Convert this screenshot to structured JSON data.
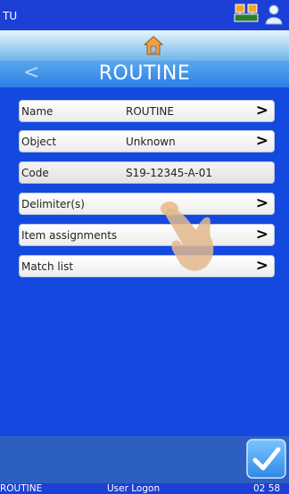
{
  "topbar": {
    "app_name": "TU",
    "icons": [
      "network-icon",
      "user-icon"
    ]
  },
  "nav": {
    "home_icon": "home-icon",
    "back_icon": "chevron-left-icon",
    "title": "ROUTINE"
  },
  "rows": [
    {
      "label": "Name",
      "value": "ROUTINE",
      "chevron": true
    },
    {
      "label": "Object",
      "value": "Unknown",
      "chevron": true
    },
    {
      "label": "Code",
      "value": "S19-12345-A-01",
      "chevron": false
    },
    {
      "label": "Delimiter(s)",
      "value": "",
      "chevron": true
    },
    {
      "label": "Item assignments",
      "value": "",
      "chevron": true
    },
    {
      "label": "Match list",
      "value": "",
      "chevron": true
    }
  ],
  "chevron_glyph": ">",
  "back_glyph": "<",
  "confirm_icon": "checkmark-icon",
  "overlay_icon": "tap-hand-icon",
  "status": {
    "left": "ROUTINE",
    "center": "User Logon",
    "right": "02 58"
  },
  "colors": {
    "background": "#1449e0",
    "title_bar": "#2c7fe6",
    "accent": "#3fa0ff"
  }
}
